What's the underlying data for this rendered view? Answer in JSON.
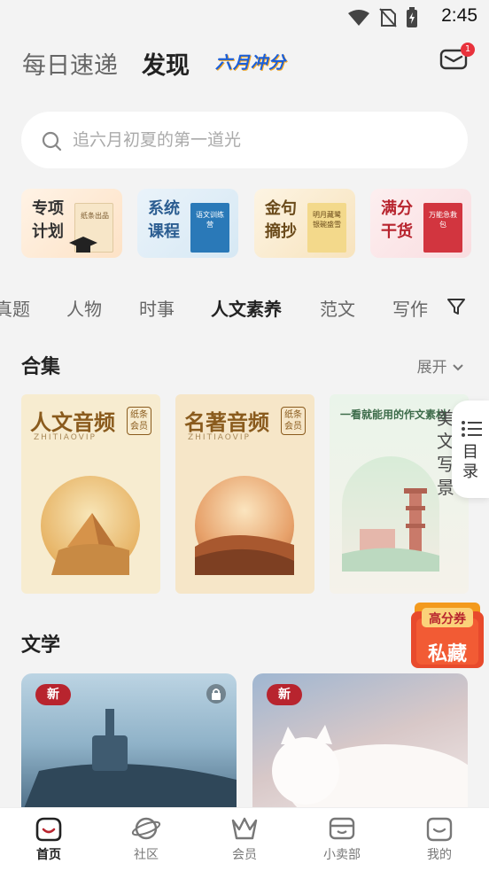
{
  "status": {
    "time": "2:45"
  },
  "header": {
    "tab_daily": "每日速递",
    "tab_discover": "发现",
    "promo_text": "六月冲分",
    "mail_badge": "1"
  },
  "search": {
    "placeholder": "追六月初夏的第一道光"
  },
  "features": [
    {
      "label": "专项计划",
      "book_text": "纸条出品"
    },
    {
      "label": "系统课程",
      "book_text": "语文训练营"
    },
    {
      "label": "金句摘抄",
      "book_text": "明月藏鹭 银碗盛雪"
    },
    {
      "label": "满分干货",
      "book_text": "万能急救包"
    }
  ],
  "categories": [
    "真题",
    "人物",
    "时事",
    "人文素养",
    "范文",
    "写作"
  ],
  "collection": {
    "title": "合集",
    "expand_label": "展开",
    "covers": [
      {
        "title": "人文音频",
        "sub": "ZHITIAOVIP",
        "seal": "纸条会员"
      },
      {
        "title": "名著音频",
        "sub": "ZHITIAOVIP",
        "seal": "纸条会员"
      },
      {
        "title": "一看就能用的作文素材",
        "vertical": "美文写景"
      }
    ]
  },
  "toc": {
    "label": "目录"
  },
  "float_promo": {
    "line1": "高分券",
    "line2": "私藏"
  },
  "literature": {
    "title": "文学",
    "badge": "新"
  },
  "nav": [
    {
      "label": "首页",
      "icon": "home-face-icon"
    },
    {
      "label": "社区",
      "icon": "planet-icon"
    },
    {
      "label": "会员",
      "icon": "crown-icon"
    },
    {
      "label": "小卖部",
      "icon": "shop-icon"
    },
    {
      "label": "我的",
      "icon": "profile-face-icon"
    }
  ],
  "colors": {
    "accent": "#b8242e",
    "promo_blue": "#1b5fd9",
    "background": "#f3f3f3"
  }
}
